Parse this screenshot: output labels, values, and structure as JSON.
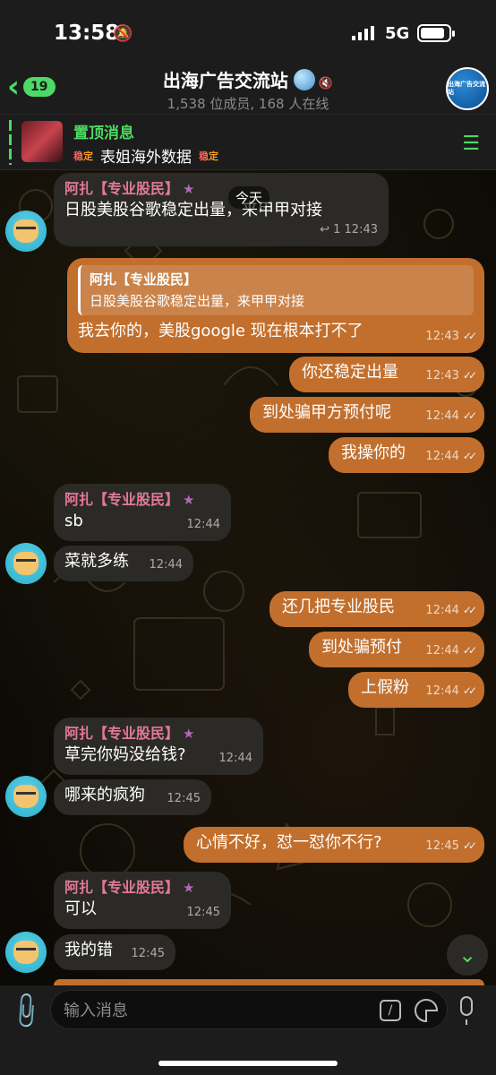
{
  "status_bar": {
    "time": "13:58",
    "network": "5G"
  },
  "header": {
    "back_count": "19",
    "title": "出海广告交流站",
    "subtitle": "1,538 位成员, 168 人在线",
    "avatar_text": "出海广告交流站"
  },
  "pinned": {
    "label": "置顶消息",
    "tag": "稳定",
    "text": "表姐海外数据"
  },
  "date_label": "今天",
  "messages": [
    {
      "sender": "阿扎【专业股民】",
      "text": "日股美股谷歌稳定出量，来甲甲对接",
      "reply_count": "1",
      "time": "12:43"
    },
    {
      "quote_name": "阿扎【专业股民】",
      "quote_text": "日股美股谷歌稳定出量，来甲甲对接",
      "text": "我去你的，美股google 现在根本打不了",
      "time": "12:43"
    },
    {
      "text": "你还稳定出量",
      "time": "12:43"
    },
    {
      "text": "到处骗甲方预付呢",
      "time": "12:44"
    },
    {
      "text": "我操你的",
      "time": "12:44"
    },
    {
      "sender": "阿扎【专业股民】",
      "text": "sb",
      "time": "12:44"
    },
    {
      "text": "菜就多练",
      "time": "12:44"
    },
    {
      "text": "还几把专业股民",
      "time": "12:44"
    },
    {
      "text": "到处骗预付",
      "time": "12:44"
    },
    {
      "text": "上假粉",
      "time": "12:44"
    },
    {
      "sender": "阿扎【专业股民】",
      "text": "草完你妈没给钱?",
      "time": "12:44"
    },
    {
      "text": "哪来的疯狗",
      "time": "12:45"
    },
    {
      "text": "心情不好，怼一怼你不行?",
      "time": "12:45"
    },
    {
      "sender": "阿扎【专业股民】",
      "text": "可以",
      "time": "12:45"
    },
    {
      "text": "我的错",
      "time": "12:45"
    }
  ],
  "composer": {
    "placeholder": "输入消息"
  },
  "colors": {
    "accent": "#4cd964",
    "outgoing": "#c26f2d",
    "incoming": "#2b2a27",
    "sender_name": "#e4789a"
  }
}
